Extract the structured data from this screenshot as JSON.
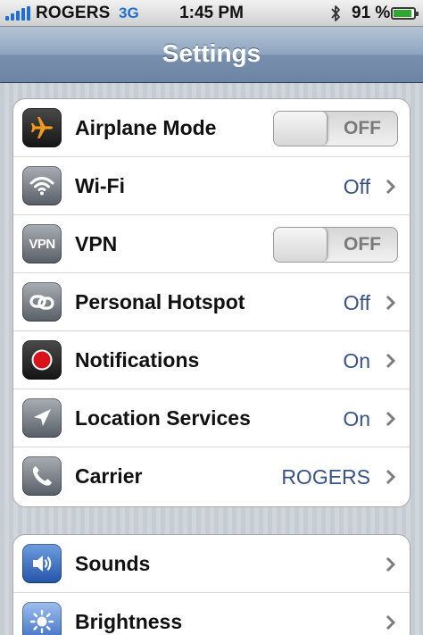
{
  "status_bar": {
    "carrier": "ROGERS",
    "network": "3G",
    "time": "1:45 PM",
    "battery_percent": "91 %",
    "battery_level": 0.91,
    "signal_bars": 5,
    "icons": [
      "signal-icon",
      "bluetooth-icon",
      "battery-icon"
    ]
  },
  "nav_bar": {
    "title": "Settings"
  },
  "settings_group_1": [
    {
      "label": "Airplane Mode",
      "control": "switch",
      "switch_text": "OFF",
      "icon": "airplane-icon"
    },
    {
      "label": "Wi-Fi",
      "control": "disclosure",
      "value": "Off",
      "icon": "wifi-icon"
    },
    {
      "label": "VPN",
      "control": "switch",
      "switch_text": "OFF",
      "icon": "vpn-icon",
      "icon_text": "VPN"
    },
    {
      "label": "Personal Hotspot",
      "control": "disclosure",
      "value": "Off",
      "icon": "hotspot-icon"
    },
    {
      "label": "Notifications",
      "control": "disclosure",
      "value": "On",
      "icon": "notifications-icon"
    },
    {
      "label": "Location Services",
      "control": "disclosure",
      "value": "On",
      "icon": "location-icon"
    },
    {
      "label": "Carrier",
      "control": "disclosure",
      "value": "ROGERS",
      "icon": "phone-icon"
    }
  ],
  "settings_group_2": [
    {
      "label": "Sounds",
      "control": "disclosure",
      "icon": "speaker-icon"
    },
    {
      "label": "Brightness",
      "control": "disclosure",
      "icon": "sun-icon"
    }
  ],
  "colors": {
    "value_text": "#385487",
    "status_accent": "#1f6fd1",
    "nav_bar": "#7890ad"
  }
}
